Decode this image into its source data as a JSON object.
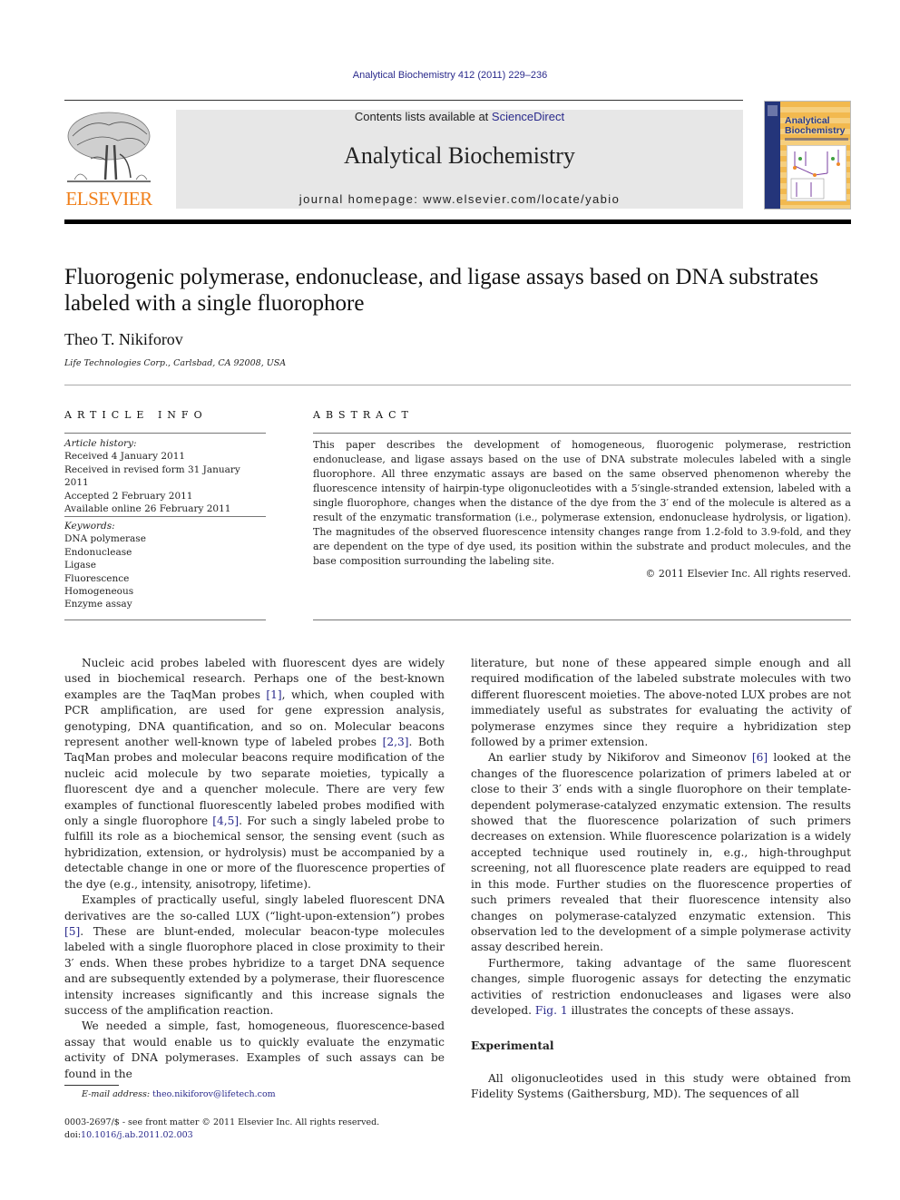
{
  "header": {
    "journal_ref": "Analytical Biochemistry 412 (2011) 229–236",
    "contents_prefix": "Contents lists available at ",
    "contents_link": "ScienceDirect",
    "journal_title": "Analytical Biochemistry",
    "homepage": "journal homepage: www.elsevier.com/locate/yabio",
    "publisher_logo_text": "ELSEVIER",
    "cover_title_line1": "Analytical",
    "cover_title_line2": "Biochemistry",
    "colors": {
      "link": "#2a2a8c",
      "elsevier_orange": "#f07f1a",
      "banner_bg": "#e7e7e7"
    }
  },
  "article": {
    "title": "Fluorogenic polymerase, endonuclease, and ligase assays based on DNA substrates labeled with a single fluorophore",
    "author": "Theo T. Nikiforov",
    "affiliation": "Life Technologies Corp., Carlsbad, CA 92008, USA"
  },
  "article_info": {
    "heading": "ARTICLE INFO",
    "history_label": "Article history:",
    "history": [
      "Received 4 January 2011",
      "Received in revised form 31 January 2011",
      "Accepted 2 February 2011",
      "Available online 26 February 2011"
    ],
    "keywords_label": "Keywords:",
    "keywords": [
      "DNA polymerase",
      "Endonuclease",
      "Ligase",
      "Fluorescence",
      "Homogeneous",
      "Enzyme assay"
    ]
  },
  "abstract": {
    "heading": "ABSTRACT",
    "text": "This paper describes the development of homogeneous, fluorogenic polymerase, restriction endonuclease, and ligase assays based on the use of DNA substrate molecules labeled with a single fluorophore. All three enzymatic assays are based on the same observed phenomenon whereby the fluorescence intensity of hairpin-type oligonucleotides with a 5′single-stranded extension, labeled with a single fluorophore, changes when the distance of the dye from the 3′ end of the molecule is altered as a result of the enzymatic transformation (i.e., polymerase extension, endonuclease hydrolysis, or ligation). The magnitudes of the observed fluorescence intensity changes range from 1.2-fold to 3.9-fold, and they are dependent on the type of dye used, its position within the substrate and product molecules, and the base composition surrounding the labeling site.",
    "copyright": "© 2011 Elsevier Inc. All rights reserved."
  },
  "body": {
    "left": {
      "p1_a": "Nucleic acid probes labeled with fluorescent dyes are widely used in biochemical research. Perhaps one of the best-known examples are the TaqMan probes ",
      "p1_ref1": "[1]",
      "p1_b": ", which, when coupled with PCR amplification, are used for gene expression analysis, genotyping, DNA quantification, and so on. Molecular beacons represent another well-known type of labeled probes ",
      "p1_ref2": "[2,3]",
      "p1_c": ". Both TaqMan probes and molecular beacons require modification of the nucleic acid molecule by two separate moieties, typically a fluorescent dye and a quencher molecule. There are very few examples of functional fluorescently labeled probes modified with only a single fluorophore ",
      "p1_ref3": "[4,5]",
      "p1_d": ". For such a singly labeled probe to fulfill its role as a biochemical sensor, the sensing event (such as hybridization, extension, or hydrolysis) must be accompanied by a detectable change in one or more of the fluorescence properties of the dye (e.g., intensity, anisotropy, lifetime).",
      "p2_a": "Examples of practically useful, singly labeled fluorescent DNA derivatives are the so-called LUX (“light-upon-extension”) probes ",
      "p2_ref": "[5]",
      "p2_b": ". These are blunt-ended, molecular beacon-type molecules labeled with a single fluorophore placed in close proximity to their 3′ ends. When these probes hybridize to a target DNA sequence and are subsequently extended by a polymerase, their fluorescence intensity increases significantly and this increase signals the success of the amplification reaction.",
      "p3": "We needed a simple, fast, homogeneous, fluorescence-based assay that would enable us to quickly evaluate the enzymatic activity of DNA polymerases. Examples of such assays can be found in the"
    },
    "right": {
      "p1": "literature, but none of these appeared simple enough and all required modification of the labeled substrate molecules with two different fluorescent moieties. The above-noted LUX probes are not immediately useful as substrates for evaluating the activity of polymerase enzymes since they require a hybridization step followed by a primer extension.",
      "p2_a": "An earlier study by Nikiforov and Simeonov ",
      "p2_ref": "[6]",
      "p2_b": " looked at the changes of the fluorescence polarization of primers labeled at or close to their 3′ ends with a single fluorophore on their template-dependent polymerase-catalyzed enzymatic extension. The results showed that the fluorescence polarization of such primers decreases on extension. While fluorescence polarization is a widely accepted technique used routinely in, e.g., high-throughput screening, not all fluorescence plate readers are equipped to read in this mode. Further studies on the fluorescence properties of such primers revealed that their fluorescence intensity also changes on polymerase-catalyzed enzymatic extension. This observation led to the development of a simple polymerase activity assay described herein.",
      "p3_a": "Furthermore, taking advantage of the same fluorescent changes, simple fluorogenic assays for detecting the enzymatic activities of restriction endonucleases and ligases were also developed. ",
      "p3_ref": "Fig. 1",
      "p3_b": " illustrates the concepts of these assays.",
      "section_heading": "Experimental",
      "p4": "All oligonucleotides used in this study were obtained from Fidelity Systems (Gaithersburg, MD). The sequences of all"
    }
  },
  "footer": {
    "email_label": "E-mail address: ",
    "email": "theo.nikiforov@lifetech.com",
    "issn_line": "0003-2697/$ - see front matter © 2011 Elsevier Inc. All rights reserved.",
    "doi_label": "doi:",
    "doi": "10.1016/j.ab.2011.02.003"
  }
}
